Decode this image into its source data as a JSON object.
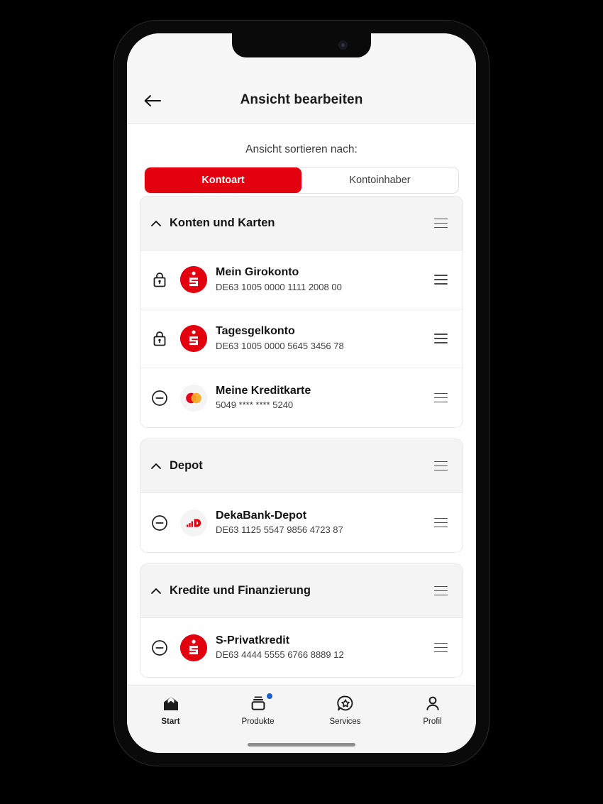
{
  "appbar": {
    "title": "Ansicht bearbeiten",
    "back_icon": "arrow-left-icon"
  },
  "sort": {
    "label": "Ansicht sortieren nach:",
    "options": [
      {
        "label": "Kontoart",
        "active": true
      },
      {
        "label": "Kontoinhaber",
        "active": false
      }
    ]
  },
  "colors": {
    "brand_red": "#e3000f",
    "badge_blue": "#1b5fd0",
    "section_bg": "#f4f4f4",
    "mastercard_red": "#e3001b",
    "mastercard_orange": "#f7a823"
  },
  "sections": [
    {
      "title": "Konten und Karten",
      "collapse_icon": "chevron-up-icon",
      "drag_icon": "drag-handle-icon",
      "rows": [
        {
          "title": "Mein Girokonto",
          "subtitle": "DE63 1005 0000 1111 2008 00",
          "state_icon": "lock-icon",
          "brand": "sparkasse",
          "drag_icon": "drag-handle-icon"
        },
        {
          "title": "Tagesgelkonto",
          "subtitle": "DE63 1005 0000 5645 3456 78",
          "state_icon": "lock-icon",
          "brand": "sparkasse",
          "drag_icon": "drag-handle-icon"
        },
        {
          "title": "Meine Kreditkarte",
          "subtitle": "5049 **** **** 5240",
          "state_icon": "minus-circle-icon",
          "brand": "mastercard",
          "drag_icon": "drag-handle-icon"
        }
      ]
    },
    {
      "title": "Depot",
      "collapse_icon": "chevron-up-icon",
      "drag_icon": "drag-handle-icon",
      "rows": [
        {
          "title": "DekaBank-Depot",
          "subtitle": "DE63 1125 5547 9856 4723 87",
          "state_icon": "minus-circle-icon",
          "brand": "deka",
          "drag_icon": "drag-handle-icon"
        }
      ]
    },
    {
      "title": "Kredite und Finanzierung",
      "collapse_icon": "chevron-up-icon",
      "drag_icon": "drag-handle-icon",
      "rows": [
        {
          "title": "S-Privatkredit",
          "subtitle": "DE63 4444 5555 6766 8889 12",
          "state_icon": "minus-circle-icon",
          "brand": "sparkasse",
          "drag_icon": "drag-handle-icon"
        }
      ]
    }
  ],
  "tabbar": [
    {
      "label": "Start",
      "icon": "home-icon",
      "active": true,
      "badge": false
    },
    {
      "label": "Produkte",
      "icon": "products-cards-icon",
      "active": false,
      "badge": true
    },
    {
      "label": "Services",
      "icon": "speech-bubble-star-icon",
      "active": false,
      "badge": false
    },
    {
      "label": "Profil",
      "icon": "person-icon",
      "active": false,
      "badge": false
    }
  ]
}
